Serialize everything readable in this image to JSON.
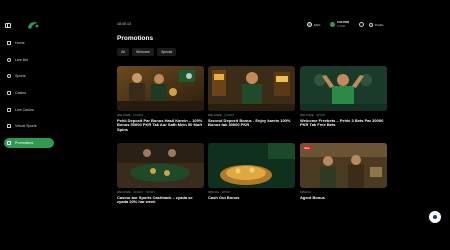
{
  "sidebar": {
    "items": [
      {
        "label": "Home",
        "icon": "home-icon"
      },
      {
        "label": "Live Bet",
        "icon": "live-icon"
      },
      {
        "label": "Sports",
        "icon": "sports-icon"
      },
      {
        "label": "Casino",
        "icon": "casino-icon"
      },
      {
        "label": "Live Casino",
        "icon": "live-casino-icon"
      },
      {
        "label": "Virtual Sports",
        "icon": "virtual-sports-icon"
      },
      {
        "label": "Promotions",
        "icon": "promotions-icon",
        "active": true
      }
    ]
  },
  "topbar": {
    "time": "18:40:13",
    "currency": "ENG",
    "balance_amount": "0.00 PKR",
    "balance_sub": "0 PKR",
    "user_label": "Profile"
  },
  "main": {
    "title": "Promotions",
    "filters": [
      "All",
      "Welcome",
      "Special"
    ],
    "cards": [
      {
        "tags": [
          "WELCOME",
          "CASINO"
        ],
        "title": "Pehli Deposit Par Bonus Hasil Karein – 100% Bonus 50000 PKR Tak Aur Sath Mein 50 Muft Spins"
      },
      {
        "tags": [
          "WELCOME",
          "CASINO"
        ],
        "title": "Second Deposit Bonus - Enjoy karein 100% Bonus tak 30000 PKR"
      },
      {
        "tags": [
          "WELCOME",
          "SPORT"
        ],
        "title": "Welcome Freebets – Pehle 3 Bets Par 30000 PKR Tak Free Bets"
      },
      {
        "tags": [
          "WELCOME",
          "CASINO",
          "SPORT"
        ],
        "title": "Casino aur Sports Cashback – zyada se zyada 20% har week"
      },
      {
        "tags": [
          "SPECIAL",
          "SPORT"
        ],
        "title": "Cash Out Bonus"
      },
      {
        "tags": [
          "SPECIAL"
        ],
        "title": "Agent Bonus",
        "badge": "New"
      }
    ]
  },
  "colors": {
    "accent": "#2e9a52",
    "background": "#000000",
    "badge": "#dd2222"
  }
}
